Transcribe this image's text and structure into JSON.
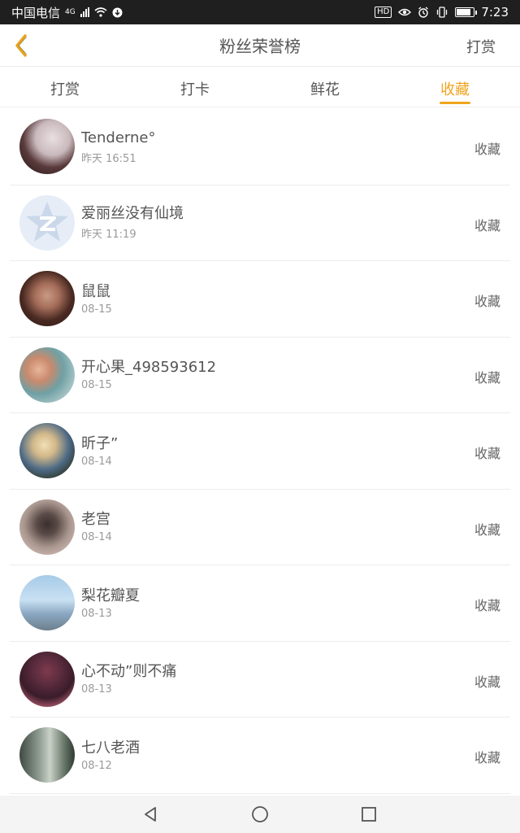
{
  "status_bar": {
    "carrier": "中国电信",
    "network": "4G",
    "time": "7:23",
    "hd": "HD"
  },
  "header": {
    "title": "粉丝荣誉榜",
    "action": "打赏"
  },
  "tabs": [
    {
      "label": "打赏",
      "active": false
    },
    {
      "label": "打卡",
      "active": false
    },
    {
      "label": "鲜花",
      "active": false
    },
    {
      "label": "收藏",
      "active": true
    }
  ],
  "rows": [
    {
      "name": "Tenderne°",
      "time": "昨天 16:51",
      "action": "收藏"
    },
    {
      "name": "爱丽丝没有仙境",
      "time": "昨天 11:19",
      "action": "收藏"
    },
    {
      "name": "鼠鼠",
      "time": "08-15",
      "action": "收藏"
    },
    {
      "name": "开心果_498593612",
      "time": "08-15",
      "action": "收藏"
    },
    {
      "name": "昕子”",
      "time": "08-14",
      "action": "收藏"
    },
    {
      "name": "老宫",
      "time": "08-14",
      "action": "收藏"
    },
    {
      "name": "梨花瓣夏",
      "time": "08-13",
      "action": "收藏"
    },
    {
      "name": "心不动”则不痛",
      "time": "08-13",
      "action": "收藏"
    },
    {
      "name": "七八老酒",
      "time": "08-12",
      "action": "收藏"
    }
  ],
  "colors": {
    "accent": "#f0a41e",
    "status_bg": "#1f1f1f"
  }
}
